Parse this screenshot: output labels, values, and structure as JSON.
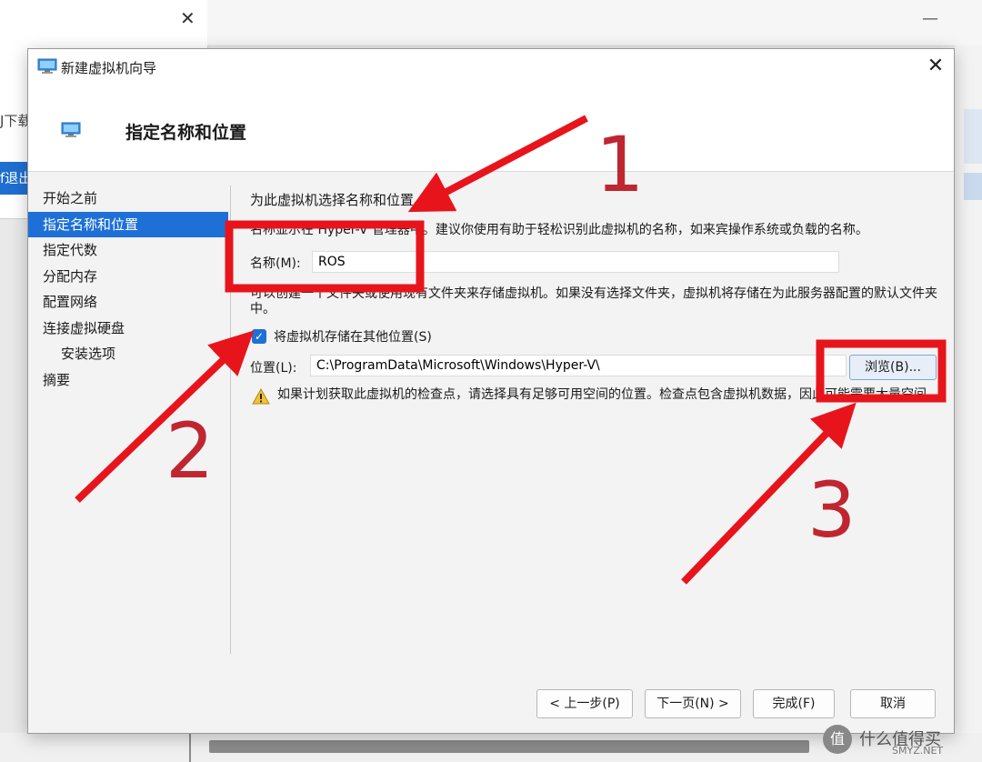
{
  "background": {
    "left_window_download_text": "J下载",
    "left_window_exit_text": "f退出"
  },
  "dialog": {
    "title": "新建虚拟机向导",
    "header_title": "指定名称和位置",
    "nav_items": [
      {
        "label": "开始之前",
        "selected": false,
        "indent": false
      },
      {
        "label": "指定名称和位置",
        "selected": true,
        "indent": false
      },
      {
        "label": "指定代数",
        "selected": false,
        "indent": false
      },
      {
        "label": "分配内存",
        "selected": false,
        "indent": false
      },
      {
        "label": "配置网络",
        "selected": false,
        "indent": false
      },
      {
        "label": "连接虚拟硬盘",
        "selected": false,
        "indent": false
      },
      {
        "label": "安装选项",
        "selected": false,
        "indent": true
      },
      {
        "label": "摘要",
        "selected": false,
        "indent": false
      }
    ],
    "main": {
      "section_title": "为此虚拟机选择名称和位置。",
      "name_description": "名称显示在 Hyper-V 管理器中。建议你使用有助于轻松识别此虚拟机的名称，如来宾操作系统或负载的名称。",
      "name_label": "名称(M):",
      "name_value": "ROS",
      "folder_description": "可以创建一个文件夹或使用现有文件夹来存储虚拟机。如果没有选择文件夹，虚拟机将存储在为此服务器配置的默认文件夹中。",
      "store_elsewhere_label": "将虚拟机存储在其他位置(S)",
      "store_elsewhere_checked": true,
      "location_label": "位置(L):",
      "location_value": "C:\\ProgramData\\Microsoft\\Windows\\Hyper-V\\",
      "browse_label": "浏览(B)...",
      "warning_text": "如果计划获取此虚拟机的检查点，请选择具有足够可用空间的位置。检查点包含虚拟机数据，因此可能需要大量空间。"
    },
    "footer": {
      "prev_label": "< 上一步(P)",
      "next_label": "下一页(N) >",
      "finish_label": "完成(F)",
      "cancel_label": "取消"
    }
  },
  "annotations": {
    "color": "#e8141c",
    "number_color": "#c0262f",
    "labels": [
      "1",
      "2",
      "3"
    ]
  },
  "watermark": {
    "icon_text": "值",
    "text": "什么值得买",
    "subtext": "SMYZ.NET"
  }
}
